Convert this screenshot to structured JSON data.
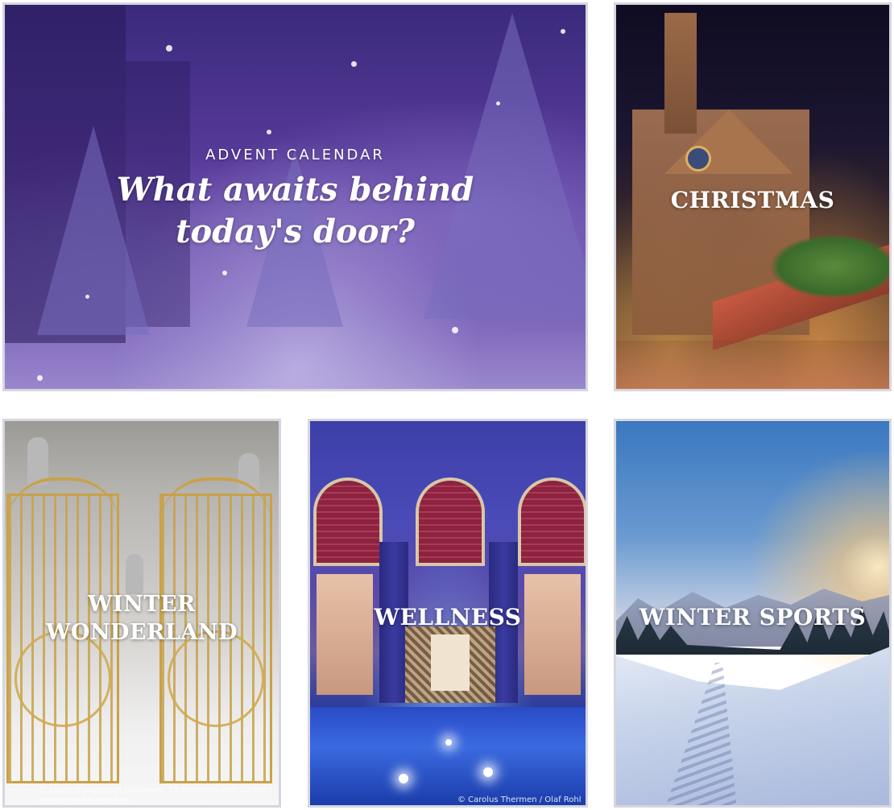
{
  "tiles": {
    "advent": {
      "kicker": "ADVENT CALENDAR",
      "headline": "What awaits behind today's door?"
    },
    "christmas": {
      "label": "CHRISTMAS"
    },
    "winter_wonderland": {
      "label_line1": "WINTER",
      "label_line2": "WONDERLAND",
      "credit_line1": "© Landeshauptstadt Hannover, FB Herrenhäuser Gärten /",
      "credit_line2": "Hassan Mahramzadeh"
    },
    "wellness": {
      "label": "WELLNESS",
      "credit": "© Carolus Thermen / Olaf Rohl"
    },
    "winter_sports": {
      "label": "WINTER SPORTS"
    }
  },
  "colors": {
    "advent_overlay": "#5a3c9c",
    "wellness_overlay": "#3d3fa8",
    "gate_gold": "#c8a24a",
    "text": "#ffffff"
  }
}
